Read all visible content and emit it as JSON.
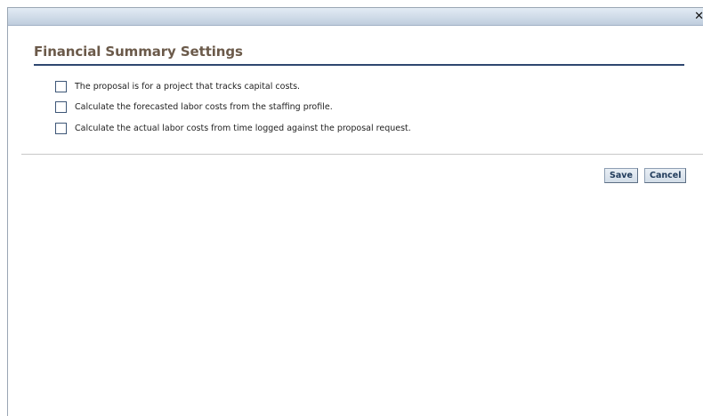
{
  "dialog": {
    "close_glyph": "✕",
    "title": "Financial Summary Settings",
    "options": [
      {
        "label": "The proposal is for a project that tracks capital costs.",
        "checked": false
      },
      {
        "label": "Calculate the forecasted labor costs from the staffing profile.",
        "checked": false
      },
      {
        "label": "Calculate the actual labor costs from time logged against the proposal request.",
        "checked": false
      }
    ],
    "buttons": {
      "save_label": "Save",
      "cancel_label": "Cancel"
    }
  },
  "icons": {
    "close": "close-icon",
    "checkbox": "checkbox-unchecked"
  },
  "colors": {
    "heading": "#6b5a4a",
    "heading_rule": "#2e4770",
    "titlebar": "#cfdbe8",
    "button_text": "#1f3a5a"
  }
}
